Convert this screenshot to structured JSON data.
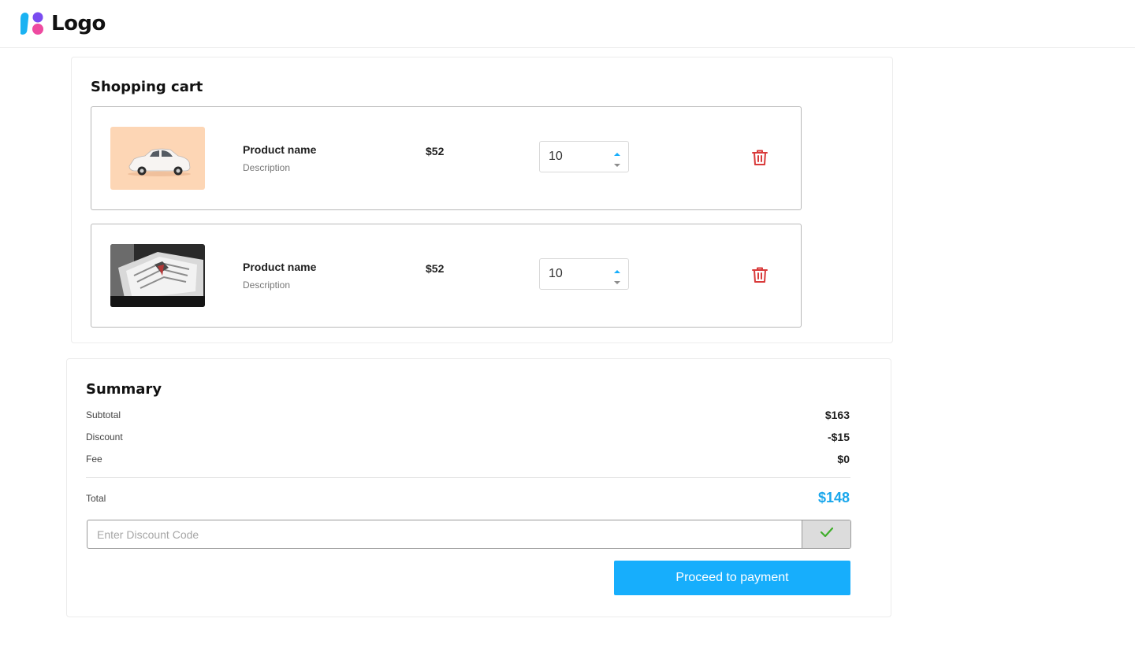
{
  "header": {
    "logo_text": "Logo"
  },
  "cart": {
    "title": "Shopping cart",
    "items": [
      {
        "name": "Product name",
        "description": "Description",
        "price": "$52",
        "quantity": "10",
        "image": "white toy car on peach background"
      },
      {
        "name": "Product name",
        "description": "Description",
        "price": "$52",
        "quantity": "10",
        "image": "folded striped dress shirts"
      }
    ]
  },
  "summary": {
    "title": "Summary",
    "subtotal_label": "Subtotal",
    "subtotal_value": "$163",
    "discount_label": "Discount",
    "discount_value": "-$15",
    "fee_label": "Fee",
    "fee_value": "$0",
    "total_label": "Total",
    "total_value": "$148",
    "discount_placeholder": "Enter Discount Code",
    "pay_label": "Proceed to payment"
  },
  "colors": {
    "accent": "#17aefc",
    "total": "#1aa7ec",
    "danger": "#d93a3a",
    "check": "#3fae2a",
    "logo_blue": "#1ab2f2",
    "logo_purple": "#7a4cf0",
    "logo_pink": "#ee4aa0"
  },
  "icons": [
    "logo-mark-icon",
    "caret-up-icon",
    "caret-down-icon",
    "trash-icon",
    "check-icon"
  ]
}
